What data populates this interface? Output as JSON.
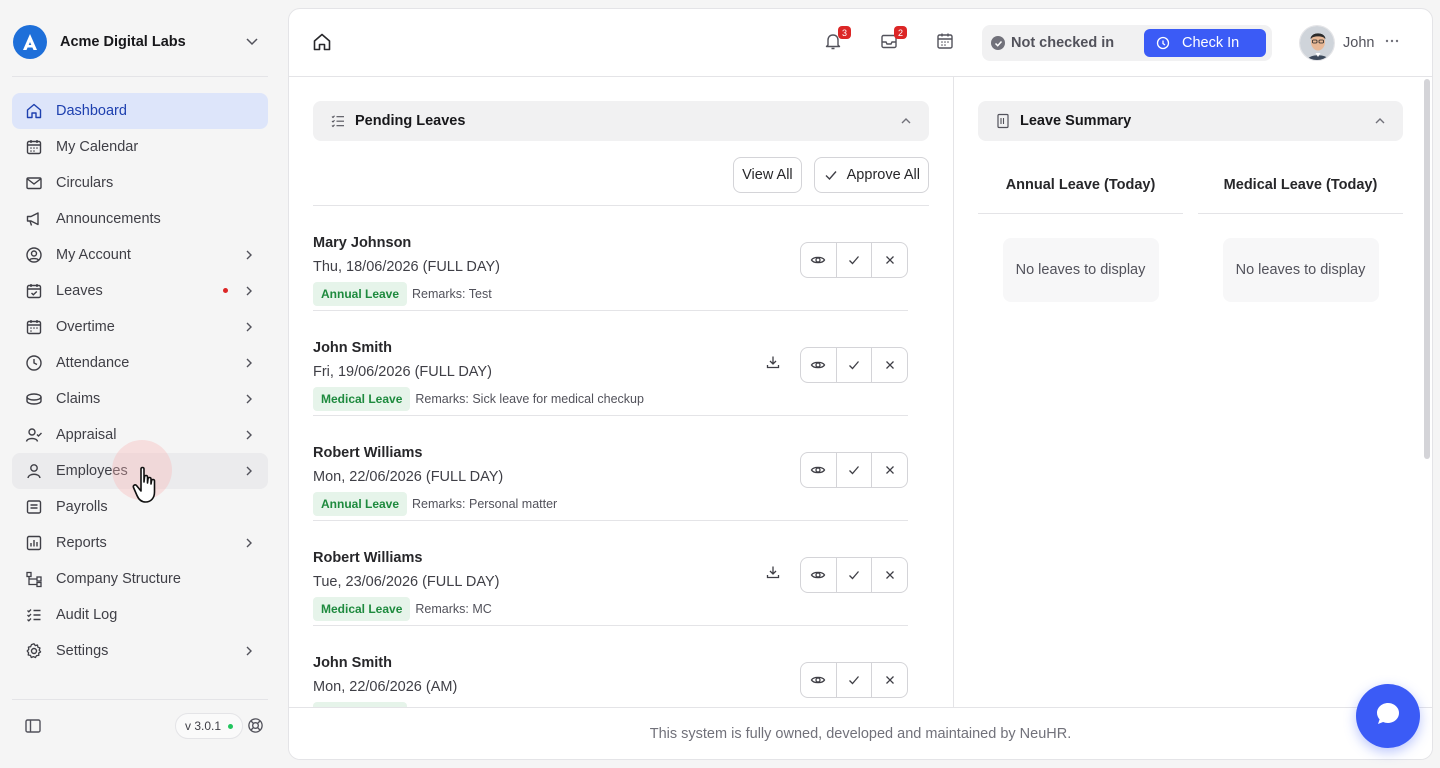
{
  "org": {
    "name": "Acme Digital Labs"
  },
  "sidebar": {
    "items": [
      {
        "label": "Dashboard",
        "icon": "home-icon"
      },
      {
        "label": "My Calendar",
        "icon": "calendar-icon"
      },
      {
        "label": "Circulars",
        "icon": "mail-icon"
      },
      {
        "label": "Announcements",
        "icon": "megaphone-icon"
      },
      {
        "label": "My Account",
        "icon": "user-circle-icon"
      },
      {
        "label": "Leaves",
        "icon": "calendar-check-icon"
      },
      {
        "label": "Overtime",
        "icon": "calendar-clock-icon"
      },
      {
        "label": "Attendance",
        "icon": "clock-icon"
      },
      {
        "label": "Claims",
        "icon": "coins-icon"
      },
      {
        "label": "Appraisal",
        "icon": "user-check-icon"
      },
      {
        "label": "Employees",
        "icon": "user-icon"
      },
      {
        "label": "Payrolls",
        "icon": "receipt-icon"
      },
      {
        "label": "Reports",
        "icon": "chart-icon"
      },
      {
        "label": "Company Structure",
        "icon": "network-icon"
      },
      {
        "label": "Audit Log",
        "icon": "list-check-icon"
      },
      {
        "label": "Settings",
        "icon": "gear-icon"
      }
    ],
    "version": "v 3.0.1"
  },
  "topbar": {
    "notifications_count": "3",
    "inbox_count": "2",
    "status": "Not checked in",
    "checkin_label": "Check In",
    "user_name": "John"
  },
  "pending": {
    "title": "Pending Leaves",
    "view_all": "View All",
    "approve_all": "Approve All",
    "items": [
      {
        "name": "Mary Johnson",
        "date": "Thu, 18/06/2026 (FULL DAY)",
        "type": "Annual Leave",
        "remarks": "Remarks: Test"
      },
      {
        "name": "John Smith",
        "date": "Fri, 19/06/2026 (FULL DAY)",
        "type": "Medical Leave",
        "remarks": "Remarks: Sick leave for medical checkup"
      },
      {
        "name": "Robert Williams",
        "date": "Mon, 22/06/2026 (FULL DAY)",
        "type": "Annual Leave",
        "remarks": "Remarks: Personal matter"
      },
      {
        "name": "Robert Williams",
        "date": "Tue, 23/06/2026 (FULL DAY)",
        "type": "Medical Leave",
        "remarks": "Remarks: MC"
      },
      {
        "name": "John Smith",
        "date": "Mon, 22/06/2026 (AM)",
        "type": "",
        "remarks": ""
      }
    ]
  },
  "summary": {
    "title": "Leave Summary",
    "annual_head": "Annual Leave (Today)",
    "medical_head": "Medical Leave (Today)",
    "empty_text": "No leaves to display"
  },
  "footer": {
    "text": "This system is fully owned, developed and maintained by NeuHR."
  },
  "colors": {
    "accent": "#3b5bf6",
    "active_bg": "#dde5fa",
    "tag_bg": "#e6f4ea",
    "tag_fg": "#1e8a3e",
    "badge": "#dc2626"
  }
}
